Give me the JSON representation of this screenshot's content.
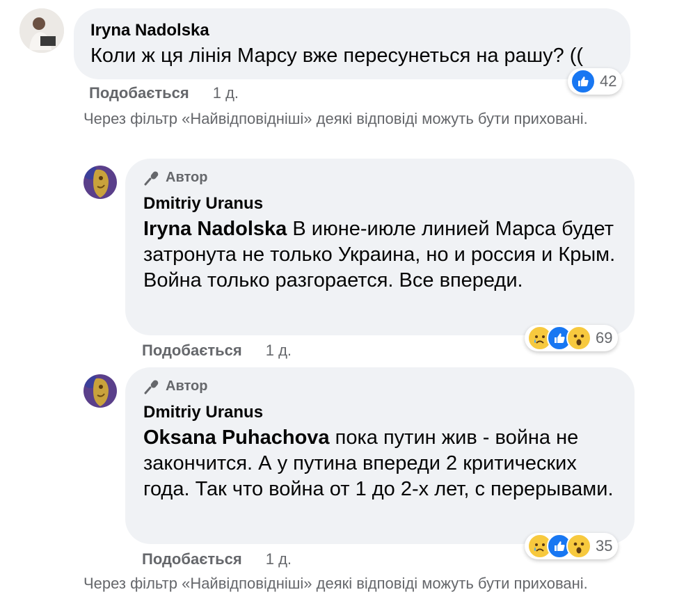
{
  "comments": [
    {
      "author": "Iryna Nadolska",
      "text": "Коли ж ця лінія Марсу вже пересунеться на рашу? ((",
      "reaction_count": "42",
      "like_label": "Подобається",
      "time": "1 д."
    },
    {
      "author_badge": "Автор",
      "author": "Dmitriy Uranus",
      "mention": "Iryna Nadolska",
      "text": "В июне-июле линией Марса будет затронута не только Украина, но и россия и Крым. Война только разгорается. Все впереди.",
      "reaction_count": "69",
      "like_label": "Подобається",
      "time": "1 д."
    },
    {
      "author_badge": "Автор",
      "author": "Dmitriy Uranus",
      "mention": "Oksana Puhachova",
      "text": "пока путин жив - война не закончится. А у путина впереди 2 критических года. Так что война от 1 до 2-х лет, с перерывами.",
      "reaction_count": "35",
      "like_label": "Подобається",
      "time": "1 д."
    }
  ],
  "notices": [
    "Через фільтр «Найвідповідніші» деякі відповіді можуть бути приховані.",
    "Через фільтр «Найвідповідніші» деякі відповіді можуть бути приховані."
  ],
  "colors": {
    "bubble": "#f0f2f5",
    "like_blue": "#1877f2",
    "secondary_text": "#65676b"
  }
}
